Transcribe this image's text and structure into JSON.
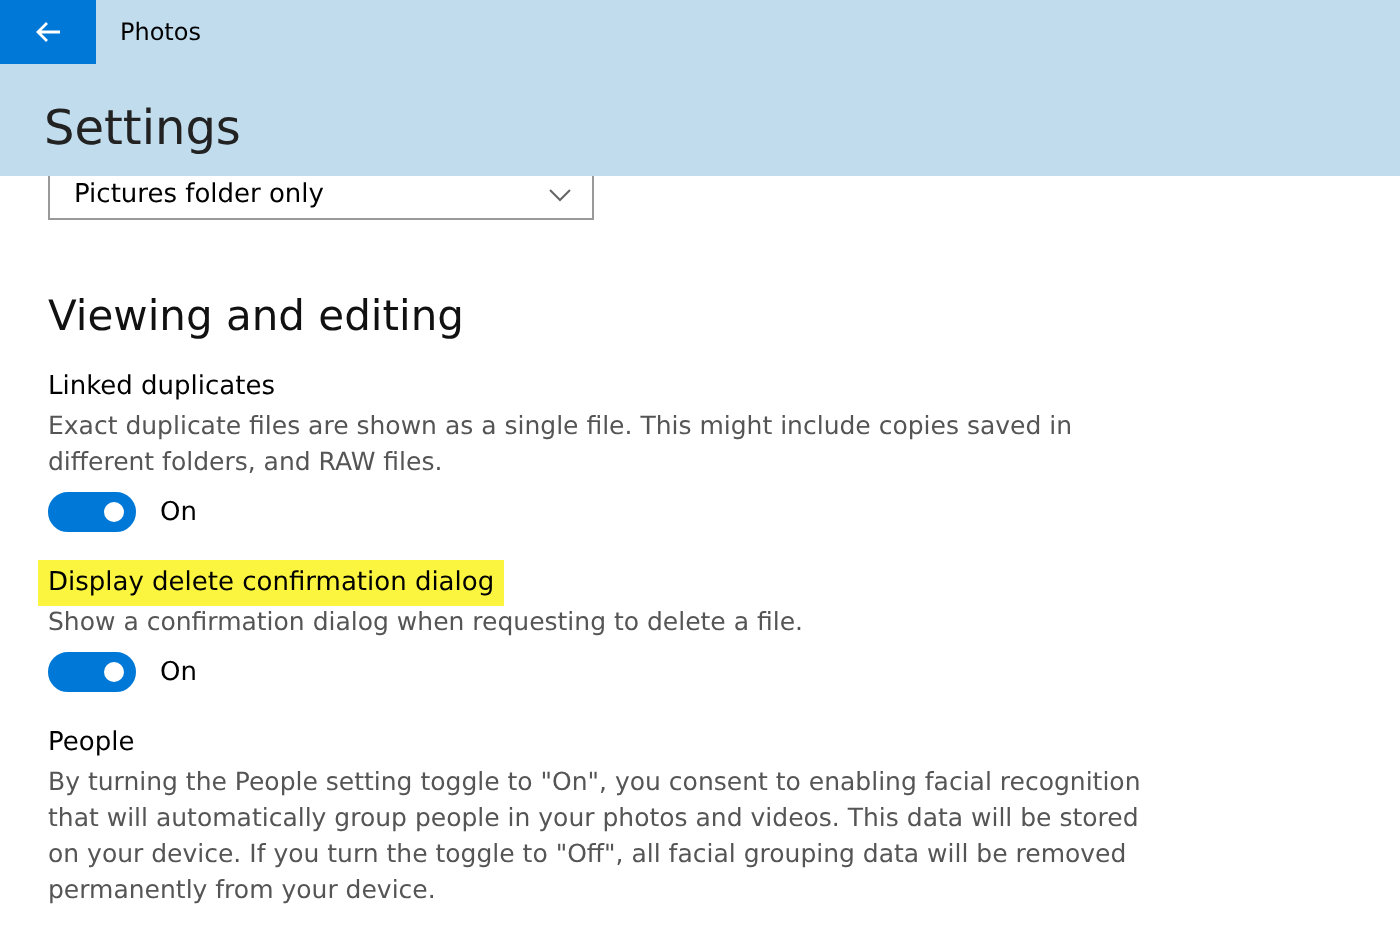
{
  "window": {
    "title": "Photos"
  },
  "page_title": "Settings",
  "dropdown": {
    "value": "Pictures folder only"
  },
  "section": {
    "title": "Viewing and editing"
  },
  "settings": [
    {
      "kind": "toggle",
      "title": "Linked duplicates",
      "highlighted": false,
      "description": "Exact duplicate files are shown as a single file. This might include copies saved in different folders, and RAW files.",
      "on": true,
      "state_label": "On"
    },
    {
      "kind": "toggle",
      "title": "Display delete confirmation dialog",
      "highlighted": true,
      "description": "Show a confirmation dialog when requesting to delete a file.",
      "on": true,
      "state_label": "On"
    },
    {
      "kind": "text",
      "title": "People",
      "highlighted": false,
      "description": "By turning the People setting toggle to \"On\", you consent to enabling facial recognition that will automatically group people in your photos and videos. This data will be stored on your device. If you turn the toggle to \"Off\", all facial grouping data will be removed permanently from your device."
    }
  ]
}
